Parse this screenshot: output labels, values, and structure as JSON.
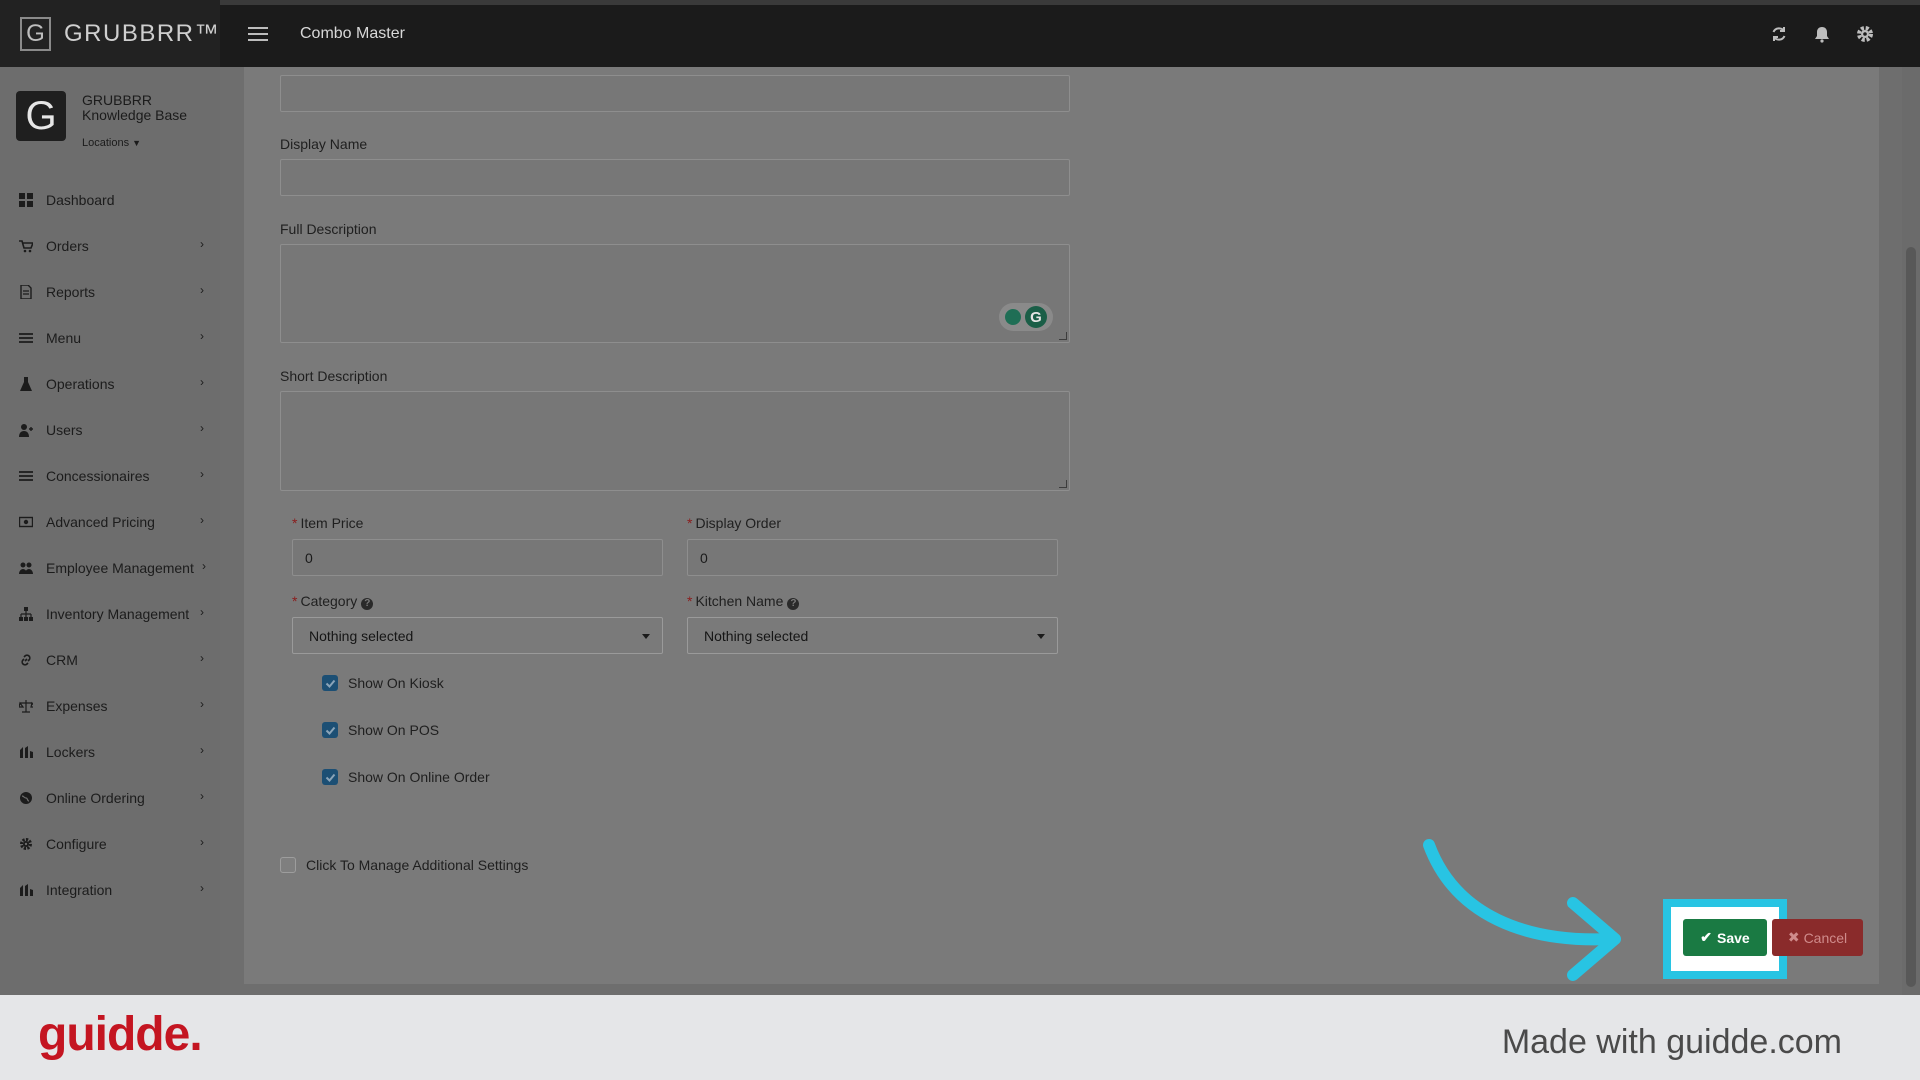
{
  "brand": {
    "name": "GRUBBRR™",
    "logo_letter": "G"
  },
  "profile": {
    "name": "GRUBBRR Knowledge Base",
    "locations": "Locations"
  },
  "sidebar": {
    "items": [
      {
        "label": "Dashboard",
        "icon": "dashboard-icon"
      },
      {
        "label": "Orders",
        "icon": "cart-icon"
      },
      {
        "label": "Reports",
        "icon": "report-icon"
      },
      {
        "label": "Menu",
        "icon": "list-icon"
      },
      {
        "label": "Operations",
        "icon": "flask-icon"
      },
      {
        "label": "Users",
        "icon": "user-plus-icon"
      },
      {
        "label": "Concessionaires",
        "icon": "list-icon"
      },
      {
        "label": "Advanced Pricing",
        "icon": "money-icon"
      },
      {
        "label": "Employee Management",
        "icon": "users-icon"
      },
      {
        "label": "Inventory Management",
        "icon": "sitemap-icon"
      },
      {
        "label": "CRM",
        "icon": "link-icon"
      },
      {
        "label": "Expenses",
        "icon": "balance-icon"
      },
      {
        "label": "Lockers",
        "icon": "locker-icon"
      },
      {
        "label": "Online Ordering",
        "icon": "globe-icon"
      },
      {
        "label": "Configure",
        "icon": "gear-icon"
      },
      {
        "label": "Integration",
        "icon": "plug-icon"
      }
    ]
  },
  "topbar": {
    "title": "Combo Master"
  },
  "form": {
    "display_name_label": "Display Name",
    "full_description_label": "Full Description",
    "short_description_label": "Short Description",
    "item_price_label": "Item Price",
    "item_price_value": "0",
    "display_order_label": "Display Order",
    "display_order_value": "0",
    "category_label": "Category",
    "category_value": "Nothing selected",
    "kitchen_name_label": "Kitchen Name",
    "kitchen_name_value": "Nothing selected",
    "required_mark": "*",
    "checks": [
      {
        "label": "Show On Kiosk",
        "checked": true
      },
      {
        "label": "Show On POS",
        "checked": true
      },
      {
        "label": "Show On Online Order",
        "checked": true
      }
    ],
    "additional_settings_label": "Click To Manage Additional Settings"
  },
  "actions": {
    "save_label": "Save",
    "cancel_label": "Cancel"
  },
  "footer": {
    "brand": "guidde.",
    "made_with": "Made with guidde.com"
  },
  "colors": {
    "save": "#1a7a43",
    "cancel": "#8a2b2b",
    "highlight": "#28c4e3",
    "brand_red": "#c41521"
  }
}
